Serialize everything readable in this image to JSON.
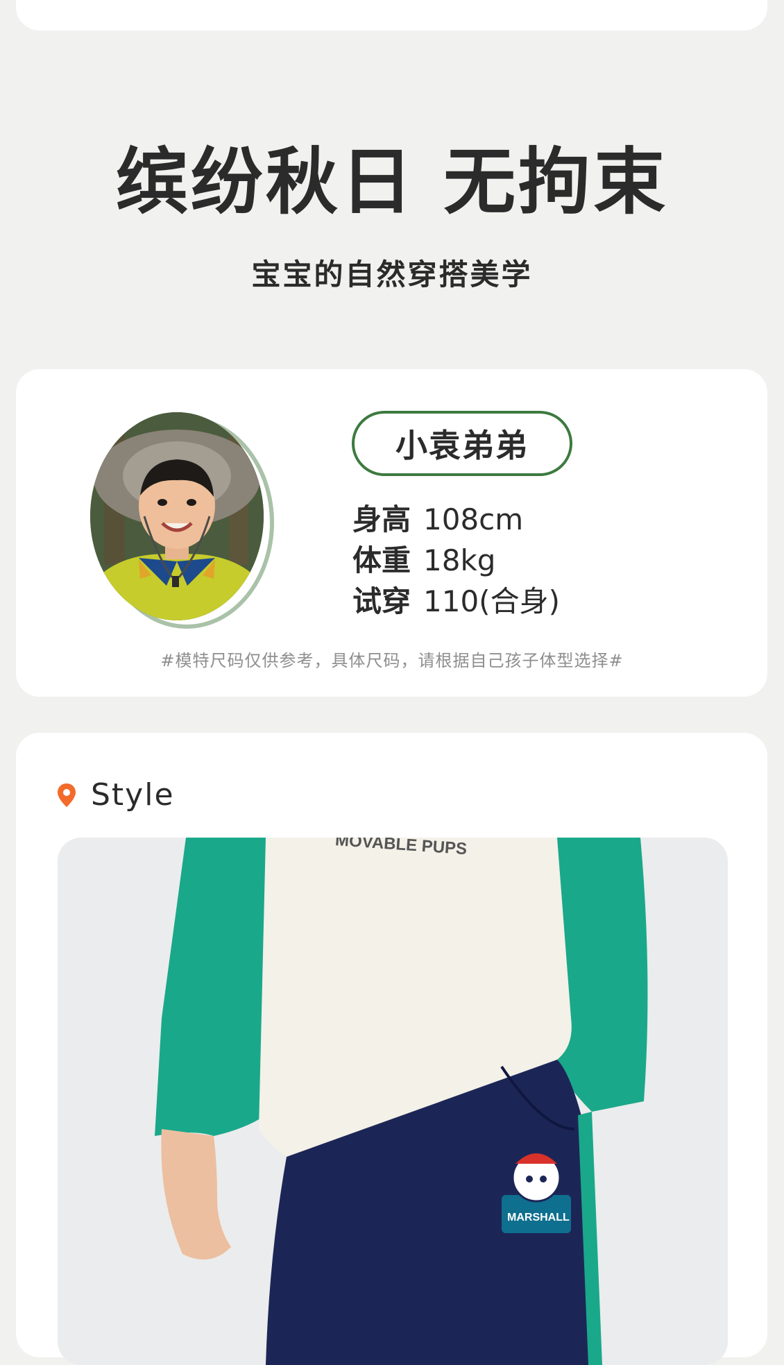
{
  "hero": {
    "title": "缤纷秋日 无拘束",
    "subtitle": "宝宝的自然穿搭美学"
  },
  "model": {
    "name": "小袁弟弟",
    "stats": [
      {
        "key": "身高",
        "value": "108cm"
      },
      {
        "key": "体重",
        "value": "18kg"
      },
      {
        "key": "试穿",
        "value": "110(合身)"
      }
    ],
    "note": "#模特尺码仅供参考，具体尺码，请根据自己孩子体型选择#",
    "badge_color": "#3d7a3f"
  },
  "style": {
    "label": "Style",
    "pin_color": "#f26b2b",
    "shirt_print": "MOVABLE PUPS",
    "patch_text": "MARSHALL"
  },
  "colors": {
    "background": "#f1f1ef",
    "card": "#ffffff",
    "sleeve_green": "#1aa88a",
    "pants_navy": "#1c2656"
  }
}
